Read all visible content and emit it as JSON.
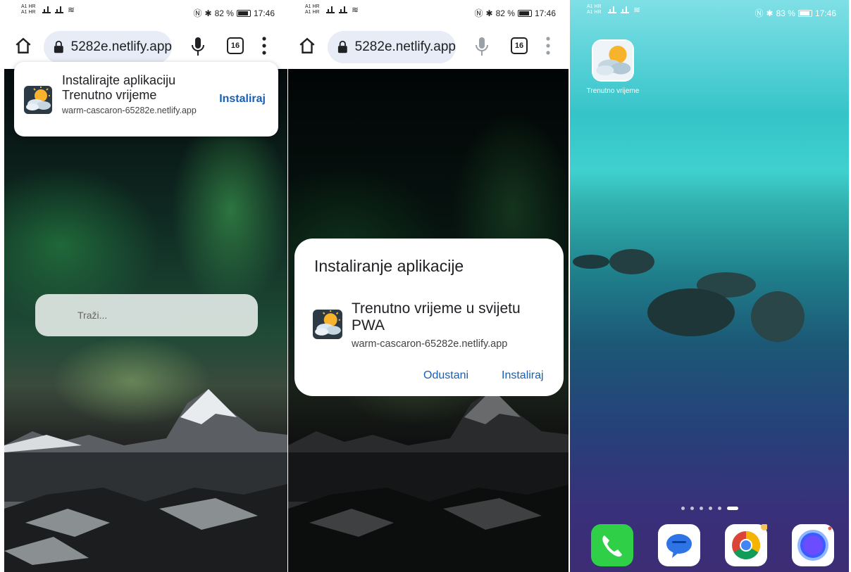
{
  "status_bar_1": {
    "carrier": "A1 HR\nA1 HR",
    "battery": "82 %",
    "time": "17:46"
  },
  "status_bar_2": {
    "carrier": "A1 HR\nA1 HR",
    "battery": "82 %",
    "time": "17:46"
  },
  "status_bar_3": {
    "carrier": "A1 HR\nA1 HR",
    "battery": "83 %",
    "time": "17:46"
  },
  "browser": {
    "url": "5282e.netlify.app",
    "tab_count": "16"
  },
  "install_banner": {
    "title": "Instalirajte aplikaciju",
    "app_name": "Trenutno vrijeme",
    "url": "warm-cascaron-65282e.netlify.app",
    "install_label": "Instaliraj"
  },
  "search": {
    "placeholder": "Traži..."
  },
  "install_dialog": {
    "title": "Instaliranje aplikacije",
    "app_name": "Trenutno vrijeme u svijetu PWA",
    "url": "warm-cascaron-65282e.netlify.app",
    "cancel_label": "Odustani",
    "install_label": "Instaliraj"
  },
  "home_screen": {
    "app_label": "Trenutno vrijeme",
    "page_count": 6,
    "active_page": 6,
    "dock": [
      "phone-icon",
      "messages-icon",
      "chrome-icon",
      "browser-icon"
    ]
  },
  "colors": {
    "accent": "#1a5fb4",
    "url_pill": "#e8ecf6"
  }
}
